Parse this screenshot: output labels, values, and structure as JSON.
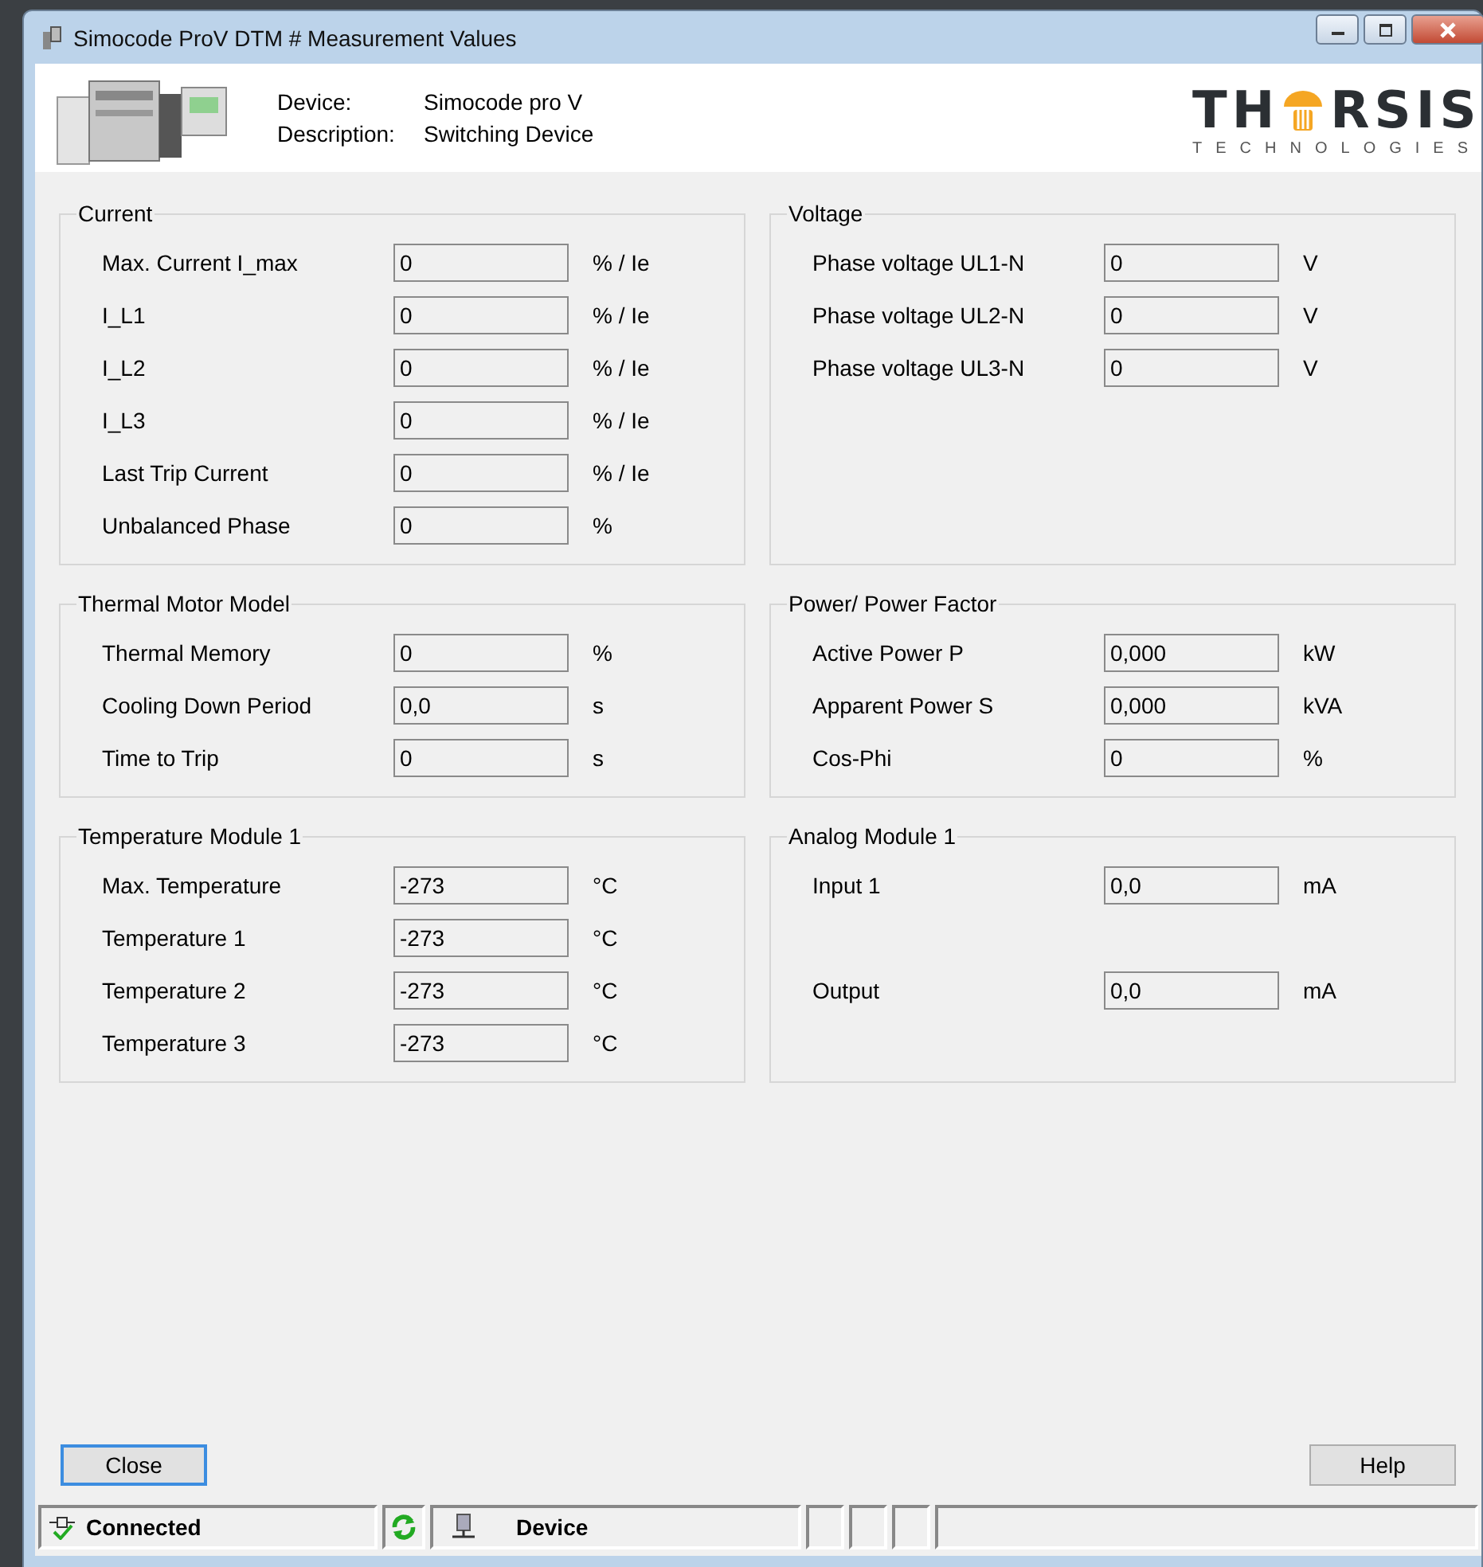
{
  "window": {
    "title": "Simocode ProV DTM # Measurement Values"
  },
  "header": {
    "fields": [
      {
        "label": "Device:",
        "value": "Simocode pro V"
      },
      {
        "label": "Description:",
        "value": "Switching Device"
      }
    ],
    "logo": {
      "left": "TH",
      "right": "RSIS",
      "sub": "TECHNOLOGIES"
    }
  },
  "groups": [
    {
      "title": "Current",
      "rows": [
        {
          "label": "Max. Current I_max",
          "value": "0",
          "unit": "% / Ie"
        },
        {
          "label": "I_L1",
          "value": "0",
          "unit": "% / Ie"
        },
        {
          "label": "I_L2",
          "value": "0",
          "unit": "% / Ie"
        },
        {
          "label": "I_L3",
          "value": "0",
          "unit": "% / Ie"
        },
        {
          "label": "Last Trip Current",
          "value": "0",
          "unit": "% / Ie"
        },
        {
          "label": "Unbalanced Phase",
          "value": "0",
          "unit": "%"
        }
      ]
    },
    {
      "title": "Voltage",
      "rows": [
        {
          "label": "Phase voltage UL1-N",
          "value": "0",
          "unit": "V"
        },
        {
          "label": "Phase voltage UL2-N",
          "value": "0",
          "unit": "V"
        },
        {
          "label": "Phase voltage UL3-N",
          "value": "0",
          "unit": "V"
        }
      ]
    },
    {
      "title": "Thermal Motor Model",
      "rows": [
        {
          "label": "Thermal Memory",
          "value": "0",
          "unit": "%"
        },
        {
          "label": "Cooling Down Period",
          "value": "0,0",
          "unit": "s"
        },
        {
          "label": "Time to Trip",
          "value": "0",
          "unit": "s"
        }
      ]
    },
    {
      "title": "Power/ Power Factor",
      "rows": [
        {
          "label": "Active Power P",
          "value": "0,000",
          "unit": "kW"
        },
        {
          "label": "Apparent Power S",
          "value": "0,000",
          "unit": "kVA"
        },
        {
          "label": "Cos-Phi",
          "value": "0",
          "unit": "%"
        }
      ]
    },
    {
      "title": "Temperature Module 1",
      "rows": [
        {
          "label": "Max. Temperature",
          "value": "-273",
          "unit": "°C"
        },
        {
          "label": "Temperature 1",
          "value": "-273",
          "unit": "°C"
        },
        {
          "label": "Temperature 2",
          "value": "-273",
          "unit": "°C"
        },
        {
          "label": "Temperature 3",
          "value": "-273",
          "unit": "°C"
        }
      ]
    },
    {
      "title": "Analog Module 1",
      "rows": [
        {
          "label": "Input 1",
          "value": "0,0",
          "unit": "mA"
        },
        {
          "label": "Output",
          "value": "0,0",
          "unit": "mA"
        }
      ]
    }
  ],
  "buttons": {
    "close": "Close",
    "help": "Help"
  },
  "status_bar": {
    "connection": "Connected",
    "device": "Device"
  }
}
